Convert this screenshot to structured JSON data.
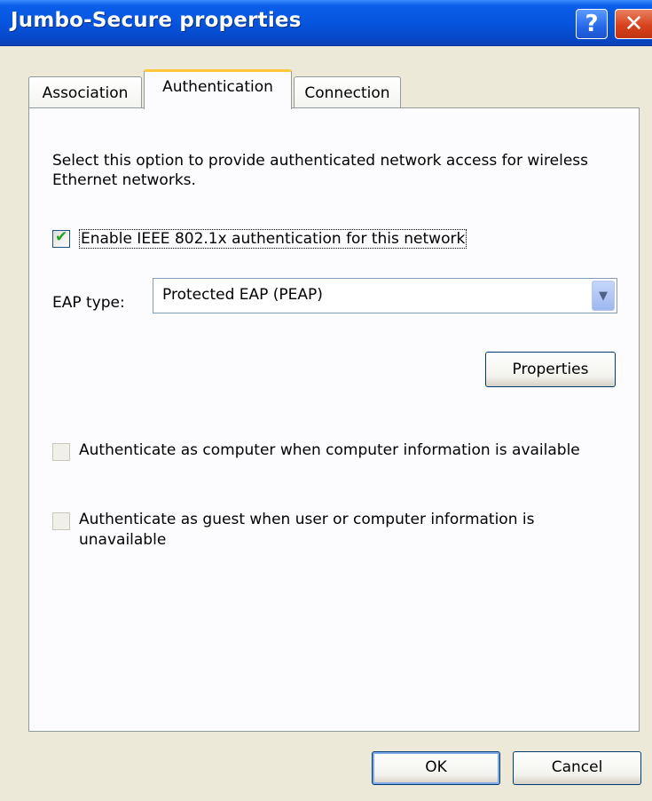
{
  "window": {
    "title": "Jumbo-Secure properties",
    "help_glyph": "?",
    "close_glyph": "✕"
  },
  "tabs": [
    {
      "label": "Association"
    },
    {
      "label": "Authentication"
    },
    {
      "label": "Connection"
    }
  ],
  "authentication": {
    "description": "Select this option to provide authenticated network access for wireless Ethernet networks.",
    "enable_8021x": {
      "label": "Enable IEEE 802.1x authentication for this network",
      "checked": true
    },
    "eap_type_label": "EAP type:",
    "eap_type_value": "Protected EAP (PEAP)",
    "properties_button": "Properties",
    "auth_as_computer": {
      "label": "Authenticate as computer when computer information is available",
      "checked": false
    },
    "auth_as_guest": {
      "label_line1": "Authenticate as guest when user or computer information is",
      "label_line2": "unavailable",
      "checked": false
    }
  },
  "footer": {
    "ok_label": "OK",
    "cancel_label": "Cancel"
  }
}
